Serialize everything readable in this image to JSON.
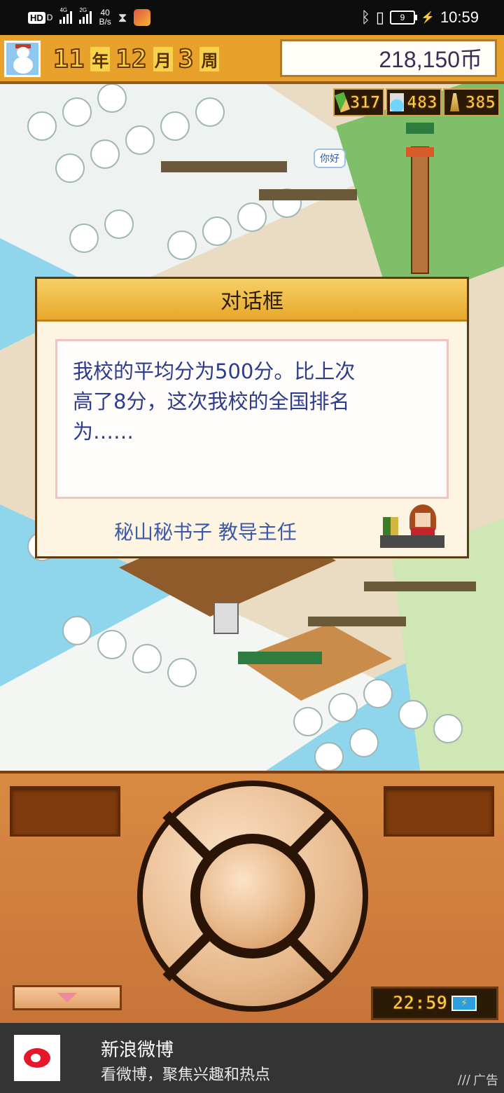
{
  "status_bar": {
    "hd": "HD",
    "hd_suffix": "D",
    "sim1": "4G",
    "sim2": "2G",
    "speed_value": "40",
    "speed_unit": "B/s",
    "battery_level": "9",
    "time": "10:59"
  },
  "header": {
    "year": "11",
    "year_unit": "年",
    "month": "12",
    "month_unit": "月",
    "week": "3",
    "week_unit": "周",
    "money": "218,150币"
  },
  "resources": [
    {
      "icon": "pencil-icon",
      "value": "317"
    },
    {
      "icon": "flask-icon",
      "value": "483"
    },
    {
      "icon": "tower-icon",
      "value": "385"
    }
  ],
  "world": {
    "speech_bubble": "你好"
  },
  "dialog": {
    "title": "对话框",
    "message": "我校的平均分为500分。比上次\n高了8分，这次我校的全国排名\n为……",
    "speaker": "秘山秘书子 教导主任"
  },
  "controller": {
    "clock": "22:59"
  },
  "ad": {
    "title": "新浪微博",
    "description": "看微博，聚焦兴趣和热点",
    "tag": "广告"
  },
  "colors": {
    "header_gold": "#e8a12b",
    "dialog_title_gold": "#e7a82a",
    "dialog_text_blue": "#2d3c8c",
    "controller_orange": "#c8743a",
    "ad_background": "#343434"
  }
}
